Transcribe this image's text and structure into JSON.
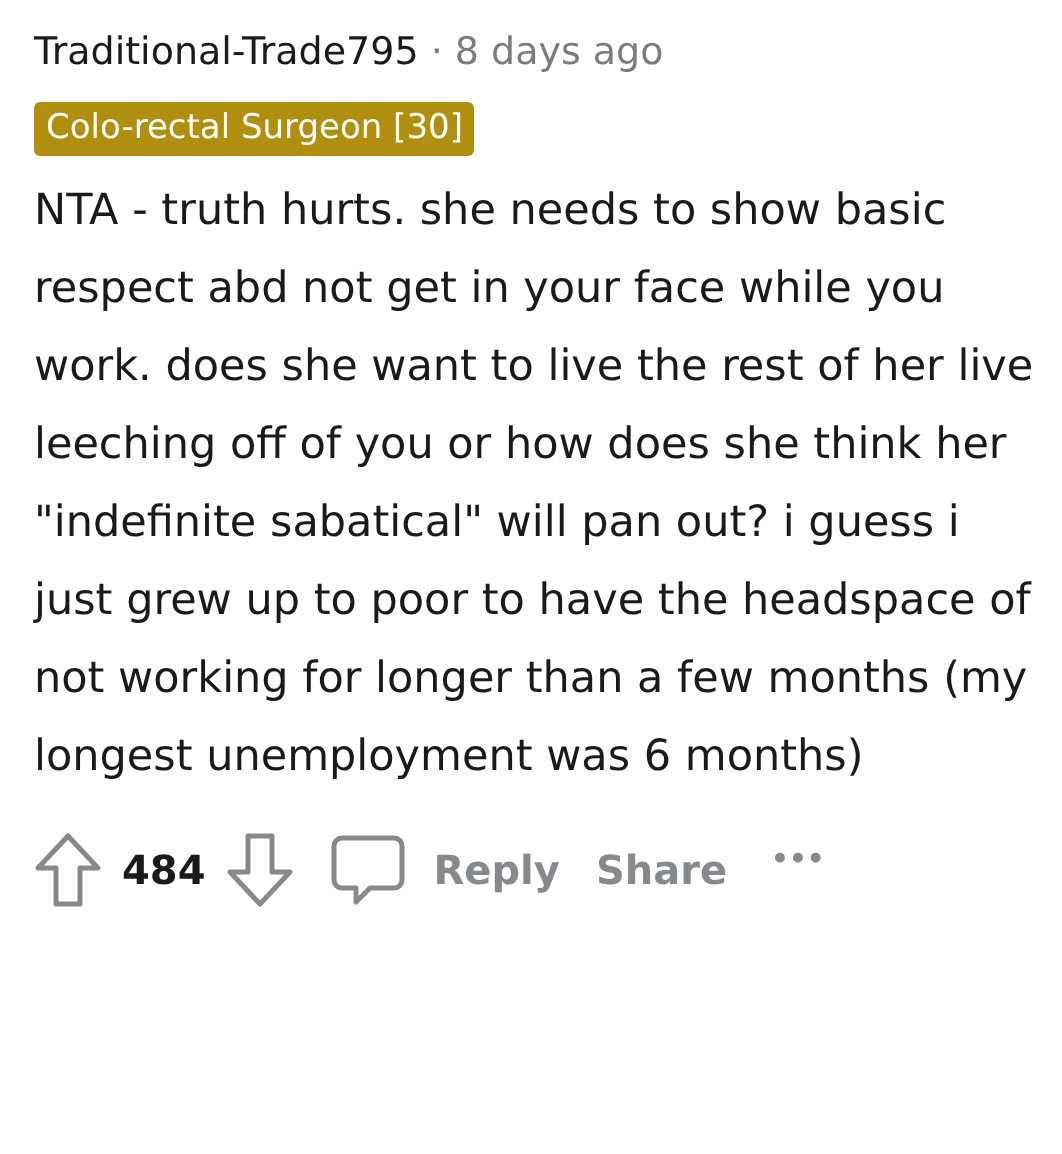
{
  "comment": {
    "author": "Traditional-Trade795",
    "separator": "·",
    "time": "8 days ago",
    "flair": "Colo-rectal Surgeon [30]",
    "body": "NTA - truth hurts. she needs to show basic respect abd not get in your face while you work. does she want to live the rest of her live leeching off of you or how does she think her \"indefinite sabatical\" will pan out? i guess i just grew up to poor to have the headspace of not working for longer than a few months (my longest unemployment was 6 months)",
    "score": "484",
    "actions": [
      "Reply",
      "Share"
    ],
    "more": "•••"
  }
}
